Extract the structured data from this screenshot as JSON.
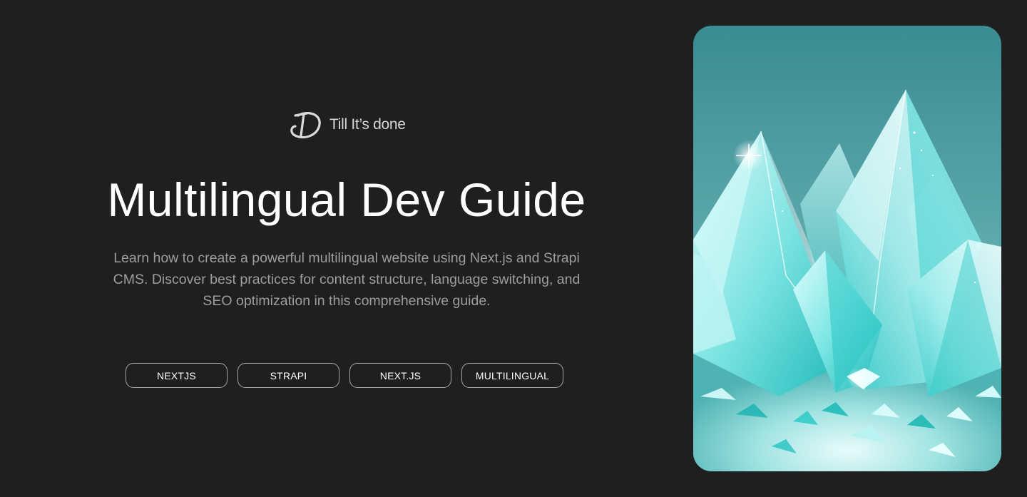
{
  "brand": {
    "name": "Till It’s done",
    "logo_icon": "td-monogram-icon"
  },
  "hero": {
    "title": "Multilingual Dev Guide",
    "description": "Learn how to create a powerful multilingual website using Next.js and Strapi CMS. Discover best practices for content structure, language switching, and SEO optimization in this comprehensive guide."
  },
  "tags": [
    {
      "label": "NEXTJS"
    },
    {
      "label": "STRAPI"
    },
    {
      "label": "NEXT.JS"
    },
    {
      "label": "MULTILINGUAL"
    }
  ],
  "image": {
    "subject": "crystal-illustration"
  },
  "colors": {
    "background": "#1f1f1f",
    "text": "#ffffff",
    "muted_text": "#9d9d9d",
    "tag_border": "#a9a9a9",
    "accent_teal": "#2fd3cf"
  }
}
